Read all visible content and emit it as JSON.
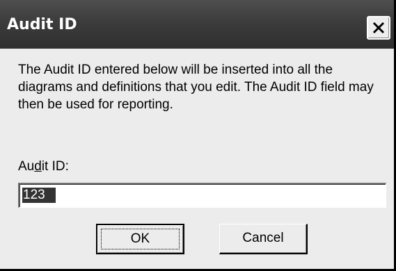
{
  "dialog": {
    "title": "Audit ID",
    "description": "The Audit ID entered below will be inserted into all the diagrams and definitions that you edit.  The Audit ID field may then be used for reporting.",
    "field_label_pre": "Au",
    "field_label_accel": "d",
    "field_label_post": "it ID:",
    "field_value": "123",
    "ok_label": "OK",
    "cancel_label": "Cancel"
  },
  "icons": {
    "close": "close-icon"
  }
}
